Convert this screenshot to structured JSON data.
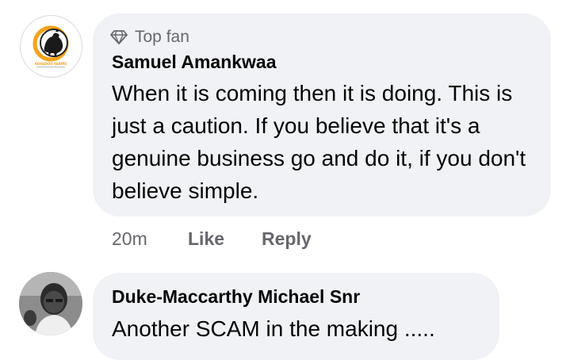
{
  "comments": [
    {
      "badge": "Top fan",
      "author": "Samuel Amankwaa",
      "text": "When it is coming then it is doing. This is just a caution. If you believe that it's a genuine business go and do it, if you don't believe simple.",
      "avatar_logo_text": "KOFADOO FARMS",
      "time": "20m",
      "like_label": "Like",
      "reply_label": "Reply"
    },
    {
      "author": "Duke-Maccarthy Michael Snr",
      "text": "Another SCAM in the making ....."
    }
  ],
  "colors": {
    "bubble": "#f0f2f5",
    "secondary_text": "#65676b",
    "primary_text": "#050505",
    "logo_orange": "#f5a31a"
  },
  "icons": {
    "badge": "diamond-icon"
  }
}
